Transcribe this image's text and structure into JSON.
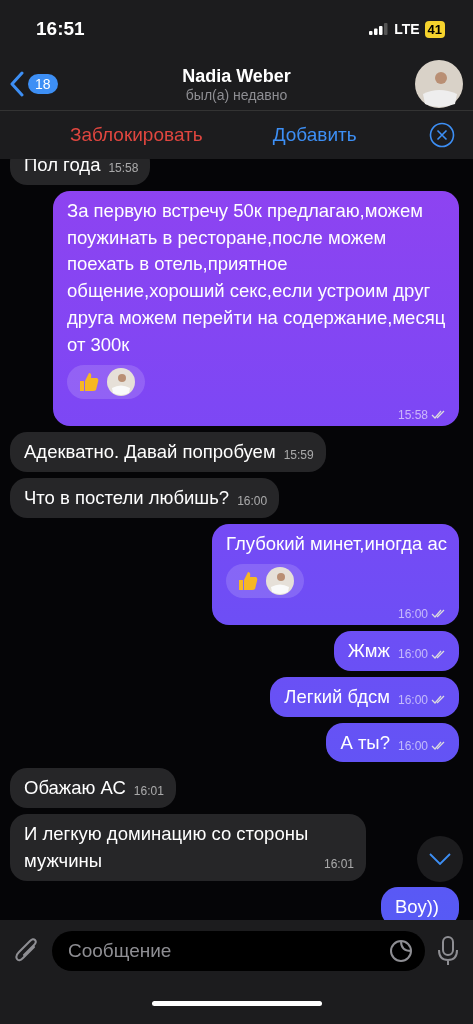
{
  "status_bar": {
    "time": "16:51",
    "network": "LTE",
    "battery": "41"
  },
  "header": {
    "back_count": "18",
    "name": "Nadia Weber",
    "status": "был(а) недавно"
  },
  "action_bar": {
    "block": "Заблокировать",
    "add": "Добавить"
  },
  "messages": [
    {
      "outgoing": false,
      "text": "Пол года",
      "time": "15:58"
    },
    {
      "outgoing": true,
      "text": "За первую встречу 50к предлагаю,можем поужинать в ресторане,после можем поехать в отель,приятное общение,хороший секс,если устроим друг друга можем перейти на содержание,месяц от 300к",
      "time": "15:58",
      "read": true,
      "liked": true
    },
    {
      "outgoing": false,
      "text": "Адекватно. Давай попробуем",
      "time": "15:59"
    },
    {
      "outgoing": false,
      "text": "Что в постели любишь?",
      "time": "16:00"
    },
    {
      "outgoing": true,
      "text": "Глубокий минет,иногда ас",
      "time": "16:00",
      "read": true,
      "liked": true
    },
    {
      "outgoing": true,
      "text": "Жмж",
      "time": "16:00",
      "read": true
    },
    {
      "outgoing": true,
      "text": "Легкий бдсм",
      "time": "16:00",
      "read": true
    },
    {
      "outgoing": true,
      "text": "А ты?",
      "time": "16:00",
      "read": true
    },
    {
      "outgoing": false,
      "text": "Обажаю АС",
      "time": "16:01"
    },
    {
      "outgoing": false,
      "text": "И легкую доминацию со стороны мужчины",
      "time": "16:01"
    },
    {
      "outgoing": true,
      "text": "Воу))"
    }
  ],
  "composer": {
    "placeholder": "Сообщение"
  }
}
